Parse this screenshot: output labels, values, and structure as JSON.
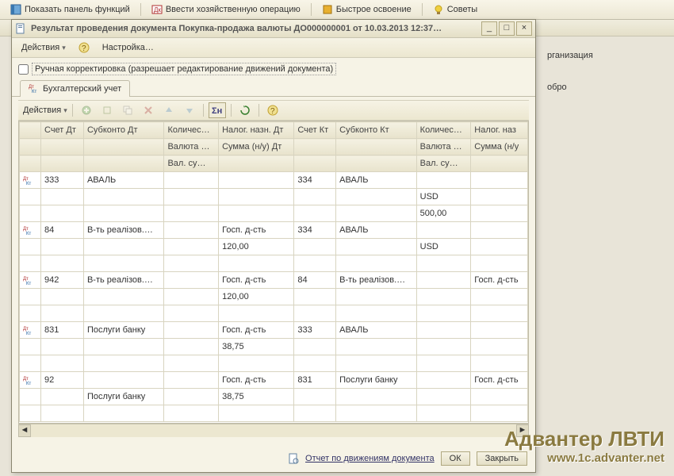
{
  "app_toolbar": {
    "show_panel": "Показать панель функций",
    "enter_oper": "Ввести хозяйственную операцию",
    "quick": "Быстрое освоение",
    "tips": "Советы"
  },
  "bg_panel": {
    "org": "рганизация",
    "dobro": "обро"
  },
  "window": {
    "title": "Результат проведения документа Покупка-продажа валюты ДО000000001 от 10.03.2013 12:37…",
    "menu": {
      "actions": "Действия",
      "settings": "Настройка…"
    },
    "manual_edit": "Ручная корректировка (разрешает редактирование движений документа)",
    "tab": "Бухгалтерский учет",
    "inner_actions": "Действия",
    "headers": {
      "h1": [
        "",
        "Счет Дт",
        "Субконто Дт",
        "Количес…",
        "Налог. назн. Дт",
        "Счет Кт",
        "Субконто Кт",
        "Количес…",
        "Налог. наз"
      ],
      "h2": [
        "",
        "",
        "",
        "Валюта …",
        "Сумма (н/у) Дт",
        "",
        "",
        "Валюта …",
        "Сумма (н/у"
      ],
      "h3": [
        "",
        "",
        "",
        "Вал. су…",
        "",
        "",
        "",
        "Вал. су…",
        ""
      ]
    },
    "rows": [
      {
        "acc_dt": "333",
        "sub_dt": "АВАЛЬ",
        "qty_dt": "",
        "tax_dt": "",
        "acc_kt": "334",
        "sub_kt": "АВАЛЬ",
        "qty_kt": "",
        "tax_kt": "",
        "cur_kt": "USD",
        "valsum_kt": "500,00"
      },
      {
        "acc_dt": "84",
        "sub_dt": "В-ть реалізов.…",
        "qty_dt": "",
        "tax_dt": "Госп. д-сть",
        "sum_dt": "120,00",
        "acc_kt": "334",
        "sub_kt": "АВАЛЬ",
        "qty_kt": "",
        "tax_kt": "",
        "cur_kt": "USD"
      },
      {
        "acc_dt": "942",
        "sub_dt": "В-ть реалізов.…",
        "qty_dt": "",
        "tax_dt": "Госп. д-сть",
        "sum_dt": "120,00",
        "acc_kt": "84",
        "sub_kt": "В-ть реалізов.…",
        "qty_kt": "",
        "tax_kt": "Госп. д-сть"
      },
      {
        "acc_dt": "831",
        "sub_dt": "Послуги банку",
        "qty_dt": "",
        "tax_dt": "Госп. д-сть",
        "sum_dt": "38,75",
        "acc_kt": "333",
        "sub_kt": "АВАЛЬ",
        "qty_kt": "",
        "tax_kt": ""
      },
      {
        "acc_dt": "92",
        "sub_dt": "",
        "sub_dt2": "Послуги банку",
        "qty_dt": "",
        "tax_dt": "Госп. д-сть",
        "sum_dt": "38,75",
        "acc_kt": "831",
        "sub_kt": "Послуги банку",
        "qty_kt": "",
        "tax_kt": "Госп. д-сть"
      }
    ],
    "footer": {
      "report": "Отчет по движениям документа",
      "ok": "ОК",
      "close": "Закрыть"
    }
  },
  "watermark": {
    "l1": "Адвантер ЛВТИ",
    "l2": "www.1c.advanter.net"
  }
}
